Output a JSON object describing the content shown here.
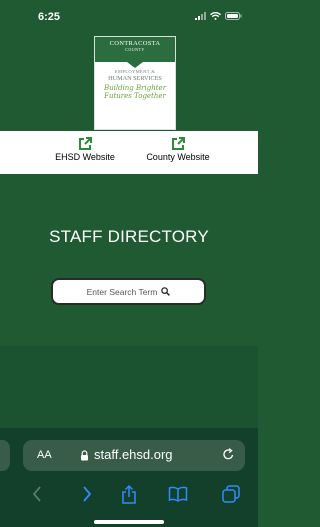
{
  "status": {
    "time": "6:25"
  },
  "logo": {
    "name_line1": "CONTRACOSTA",
    "name_line2": "COUNTY",
    "dept_line1": "EMPLOYMENT &",
    "dept_line2": "HUMAN SERVICES",
    "tagline_line1": "Building Brighter",
    "tagline_line2": "Futures Together"
  },
  "links": {
    "ehsd_label": "EHSD Website",
    "county_label": "County Website"
  },
  "main": {
    "title": "STAFF DIRECTORY",
    "search_placeholder": "Enter Search Term"
  },
  "browser": {
    "text_size_label": "AA",
    "url": "staff.ehsd.org"
  },
  "colors": {
    "brand_green": "#1f5a32",
    "link_green": "#2e8b3c",
    "browser_bar": "#12402a",
    "url_field": "#385c48"
  },
  "icons": [
    "signal-icon",
    "wifi-icon",
    "battery-icon",
    "external-link-icon",
    "search-icon",
    "lock-icon",
    "reload-icon",
    "back-icon",
    "forward-icon",
    "share-icon",
    "bookmarks-icon",
    "tabs-icon"
  ]
}
